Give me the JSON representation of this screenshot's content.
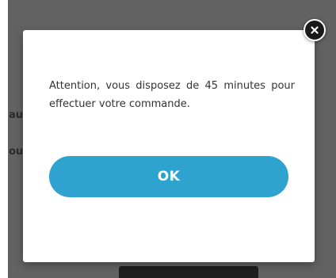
{
  "dialog": {
    "message": "Attention, vous disposez de 45 minutes pour effectuer votre commande.",
    "ok_label": "OK",
    "close_icon": "close-icon"
  },
  "background": {
    "text_fragment_1": "au",
    "text_fragment_2": "ou"
  },
  "colors": {
    "overlay": "#626262",
    "button": "#2fa3d0",
    "close_button": "#1a1a1a"
  }
}
